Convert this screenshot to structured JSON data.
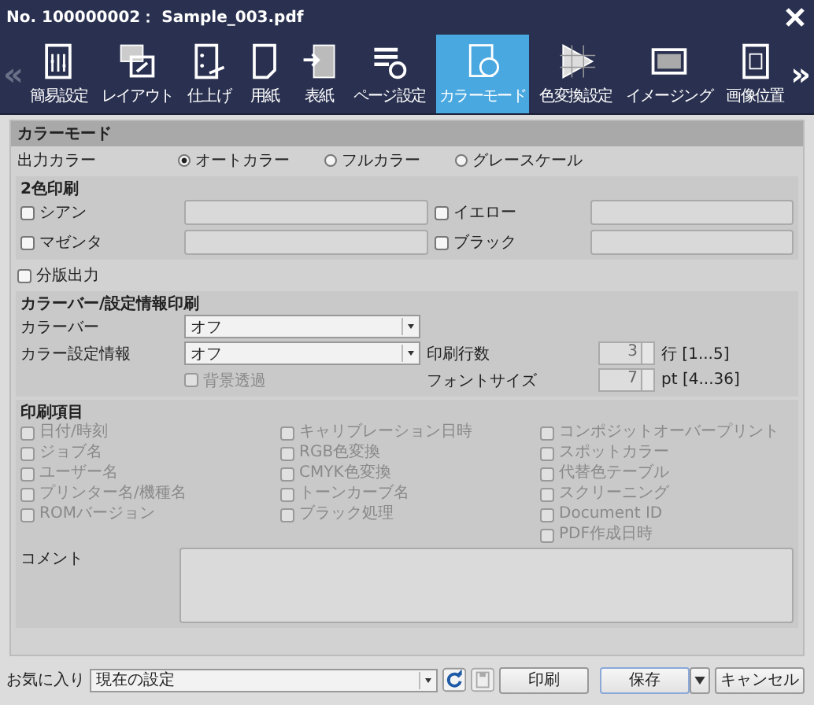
{
  "window": {
    "title": "No. 100000002： Sample_003.pdf"
  },
  "nav": {
    "prev": "«",
    "next": "»"
  },
  "tabs": [
    {
      "label": "簡易設定",
      "selected": false
    },
    {
      "label": "レイアウト",
      "selected": false
    },
    {
      "label": "仕上げ",
      "selected": false
    },
    {
      "label": "用紙",
      "selected": false
    },
    {
      "label": "表紙",
      "selected": false
    },
    {
      "label": "ページ設定",
      "selected": false
    },
    {
      "label": "カラーモード",
      "selected": true
    },
    {
      "label": "色変換設定",
      "selected": false
    },
    {
      "label": "イメージング",
      "selected": false
    },
    {
      "label": "画像位置",
      "selected": false
    }
  ],
  "section_title": "カラーモード",
  "output_color": {
    "label": "出力カラー",
    "options": [
      {
        "label": "オートカラー",
        "selected": true
      },
      {
        "label": "フルカラー",
        "selected": false
      },
      {
        "label": "グレースケール",
        "selected": false
      }
    ]
  },
  "two_color": {
    "title": "2色印刷",
    "items": [
      {
        "label": "シアン",
        "checked": false
      },
      {
        "label": "イエロー",
        "checked": false
      },
      {
        "label": "マゼンタ",
        "checked": false
      },
      {
        "label": "ブラック",
        "checked": false
      }
    ]
  },
  "separation": {
    "label": "分版出力",
    "checked": false
  },
  "color_bar": {
    "title": "カラーバー/設定情報印刷",
    "color_bar": {
      "label": "カラーバー",
      "value": "オフ"
    },
    "color_info": {
      "label": "カラー設定情報",
      "value": "オフ"
    },
    "background": {
      "label": "背景透過",
      "checked": false,
      "disabled": true
    },
    "print_lines": {
      "label": "印刷行数",
      "value": "3",
      "unit": "行 [1...5]"
    },
    "font_size": {
      "label": "フォントサイズ",
      "value": "7",
      "unit": "pt [4...36]"
    }
  },
  "print_items": {
    "title": "印刷項目",
    "columns": [
      [
        {
          "label": "日付/時刻",
          "checked": false,
          "disabled": true
        },
        {
          "label": "ジョブ名",
          "checked": false,
          "disabled": true
        },
        {
          "label": "ユーザー名",
          "checked": false,
          "disabled": true
        },
        {
          "label": "プリンター名/機種名",
          "checked": false,
          "disabled": true
        },
        {
          "label": "ROMバージョン",
          "checked": false,
          "disabled": true
        }
      ],
      [
        {
          "label": "キャリブレーション日時",
          "checked": false,
          "disabled": true
        },
        {
          "label": "RGB色変換",
          "checked": false,
          "disabled": true
        },
        {
          "label": "CMYK色変換",
          "checked": false,
          "disabled": true
        },
        {
          "label": "トーンカーブ名",
          "checked": false,
          "disabled": true
        },
        {
          "label": "ブラック処理",
          "checked": false,
          "disabled": true
        }
      ],
      [
        {
          "label": "コンポジットオーバープリント",
          "checked": false,
          "disabled": true
        },
        {
          "label": "スポットカラー",
          "checked": false,
          "disabled": true
        },
        {
          "label": "代替色テーブル",
          "checked": false,
          "disabled": true
        },
        {
          "label": "スクリーニング",
          "checked": false,
          "disabled": true
        },
        {
          "label": "Document ID",
          "checked": false,
          "disabled": true
        },
        {
          "label": "PDF作成日時",
          "checked": false,
          "disabled": true
        }
      ]
    ],
    "comment_label": "コメント"
  },
  "footer": {
    "favorites_label": "お気に入り",
    "favorites_value": "現在の設定",
    "print": "印刷",
    "save": "保存",
    "cancel": "キャンセル"
  }
}
